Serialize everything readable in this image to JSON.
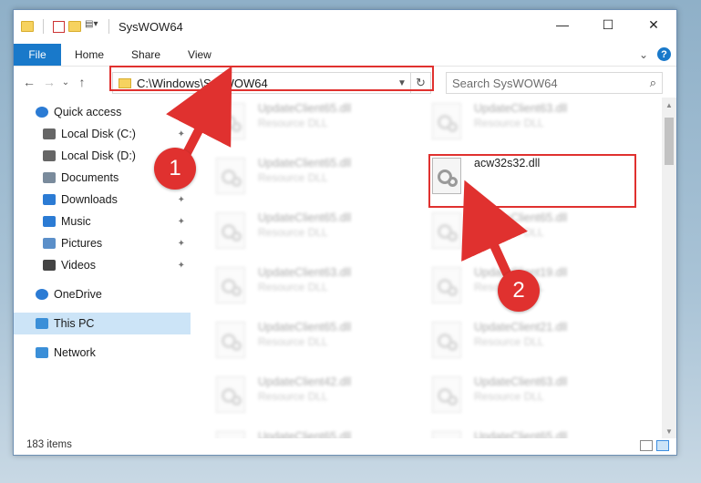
{
  "window": {
    "title": "SysWOW64",
    "controls": {
      "minimize": "—",
      "maximize": "☐",
      "close": "✕"
    }
  },
  "ribbon": {
    "tabs": [
      "File",
      "Home",
      "Share",
      "View"
    ],
    "expand": "⌄",
    "help": "?"
  },
  "nav": {
    "back": "←",
    "forward": "→",
    "recent": "⌄",
    "up": "↑",
    "address": "C:\\Windows\\SysWOW64",
    "refresh": "↻",
    "search_placeholder": "Search SysWOW64",
    "search_icon": "⌕"
  },
  "sidebar": {
    "items": [
      {
        "label": "Quick access",
        "icon": "star-icon",
        "pinned": false,
        "selected": false,
        "sub": false
      },
      {
        "label": "Local Disk (C:)",
        "icon": "drive-icon",
        "pinned": true,
        "selected": false,
        "sub": true
      },
      {
        "label": "Local Disk (D:)",
        "icon": "drive-icon",
        "pinned": false,
        "selected": false,
        "sub": true
      },
      {
        "label": "Documents",
        "icon": "documents-icon",
        "pinned": true,
        "selected": false,
        "sub": true
      },
      {
        "label": "Downloads",
        "icon": "download-icon",
        "pinned": true,
        "selected": false,
        "sub": true
      },
      {
        "label": "Music",
        "icon": "music-icon",
        "pinned": true,
        "selected": false,
        "sub": true
      },
      {
        "label": "Pictures",
        "icon": "pictures-icon",
        "pinned": true,
        "selected": false,
        "sub": true
      },
      {
        "label": "Videos",
        "icon": "videos-icon",
        "pinned": true,
        "selected": false,
        "sub": true
      },
      {
        "label": "OneDrive",
        "icon": "cloud-icon",
        "pinned": false,
        "selected": false,
        "sub": false
      },
      {
        "label": "This PC",
        "icon": "computer-icon",
        "pinned": false,
        "selected": true,
        "sub": false
      },
      {
        "label": "Network",
        "icon": "network-icon",
        "pinned": false,
        "selected": false,
        "sub": false
      }
    ],
    "pin_glyph": "📌"
  },
  "files": [
    {
      "name": "UpdateClient65.dll",
      "type": "Resource DLL",
      "highlighted": false
    },
    {
      "name": "UpdateClient63.dll",
      "type": "Resource DLL",
      "highlighted": false
    },
    {
      "name": "UpdateClient65.dll",
      "type": "Resource DLL",
      "highlighted": false
    },
    {
      "name": "acw32s32.dll",
      "type": "",
      "highlighted": true
    },
    {
      "name": "UpdateClient65.dll",
      "type": "Resource DLL",
      "highlighted": false
    },
    {
      "name": "UpdateClient65.dll",
      "type": "Resource DLL",
      "highlighted": false
    },
    {
      "name": "UpdateClient63.dll",
      "type": "Resource DLL",
      "highlighted": false
    },
    {
      "name": "UpdateClient19.dll",
      "type": "Resource DLL",
      "highlighted": false
    },
    {
      "name": "UpdateClient65.dll",
      "type": "Resource DLL",
      "highlighted": false
    },
    {
      "name": "UpdateClient21.dll",
      "type": "Resource DLL",
      "highlighted": false
    },
    {
      "name": "UpdateClient42.dll",
      "type": "Resource DLL",
      "highlighted": false
    },
    {
      "name": "UpdateClient63.dll",
      "type": "Resource DLL",
      "highlighted": false
    },
    {
      "name": "UpdateClient65.dll",
      "type": "Resource DLL",
      "highlighted": false
    },
    {
      "name": "UpdateClient65.dll",
      "type": "Resource DLL",
      "highlighted": false
    }
  ],
  "status": {
    "item_count": "183 items"
  },
  "annotations": {
    "step1": "1",
    "step2": "2",
    "color": "#e0312f"
  }
}
